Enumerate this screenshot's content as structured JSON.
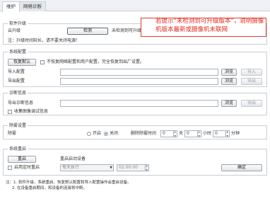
{
  "tabs": [
    "维护",
    "网络诊断"
  ],
  "upgrade": {
    "title": "软件升级",
    "cloud_label": "云升级",
    "check_button": "检测",
    "status_text": "未检测到可升级版本。",
    "warning": "注：升级时间较长，请不要关闭电源！"
  },
  "annotation": {
    "text": "若提示“未检测到可升级版本”，说明摄像机版本最新或摄像机未联网"
  },
  "config": {
    "title": "系统配置",
    "restore_button": "恢复默认",
    "keep_checkbox_label": "不恢复网络配置和用户配置，完全恢复到出厂设置。",
    "import_label": "导入配置",
    "export_label": "导出配置",
    "browse_button": "浏览",
    "import_button": "导入",
    "export_button": "导出"
  },
  "diagnose": {
    "title": "诊断信息",
    "export_label": "导出诊断信息",
    "collect_label": "收集图像调试信息",
    "browse_button": "浏览",
    "export_button": "导出"
  },
  "defog": {
    "title": "除雾设置",
    "label": "除雾",
    "on_label": "开启",
    "off_label": "关闭",
    "selected": "off",
    "period_label": "删除除雾时间",
    "unit_day": "天",
    "unit_hour": "小时",
    "unit_minute": "分钟",
    "day_value": "0",
    "hour_value": "0",
    "minute_value": "0"
  },
  "reboot": {
    "title": "系统重启",
    "reboot_button": "重启",
    "schedule_label": "重启启动设备",
    "timer_checkbox_label": "启用定时重启",
    "frequency": "每天执行",
    "time": "02:00:00",
    "confirm_button": "确定"
  },
  "notes": [
    "注：1. 软件升级、系统重启、恢复默认配置和导入配置操作会重启设备。",
    "2. 在设备重启期间，和设备的连接将中断。"
  ],
  "colors": {
    "annotation": "#e02a1e",
    "border": "#c8cdd4"
  }
}
